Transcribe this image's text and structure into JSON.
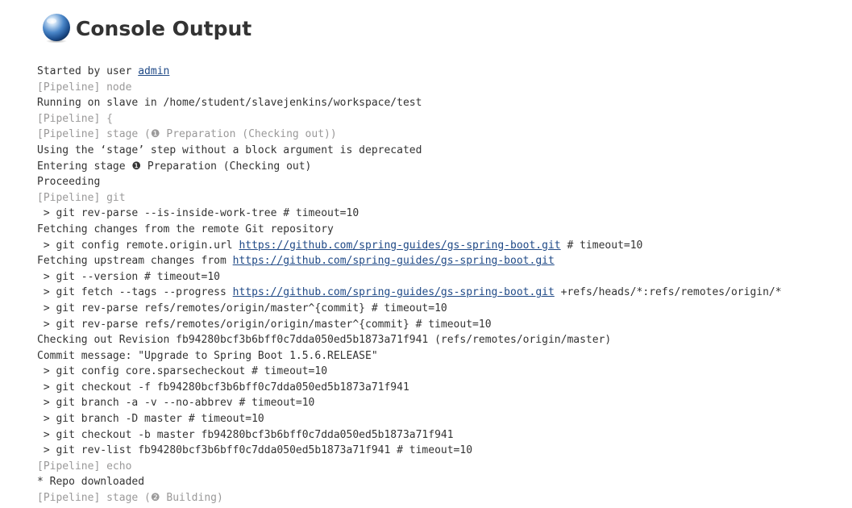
{
  "header": {
    "title": "Console Output",
    "icon": "terminal-globe-icon"
  },
  "colors": {
    "text": "#333333",
    "pipeline": "#9a9999",
    "link": "#204a87"
  },
  "lines": [
    {
      "type": "user",
      "segments": [
        {
          "text": "Started by user "
        },
        {
          "text": "admin",
          "link": true
        }
      ]
    },
    {
      "type": "pipeline",
      "segments": [
        {
          "text": "[Pipeline] node"
        }
      ]
    },
    {
      "type": "text",
      "segments": [
        {
          "text": "Running on slave in /home/student/slavejenkins/workspace/test"
        }
      ]
    },
    {
      "type": "pipeline",
      "segments": [
        {
          "text": "[Pipeline] {"
        }
      ]
    },
    {
      "type": "pipeline",
      "segments": [
        {
          "text": "[Pipeline] stage (❶ Preparation (Checking out))"
        }
      ]
    },
    {
      "type": "text",
      "segments": [
        {
          "text": "Using the ‘stage’ step without a block argument is deprecated"
        }
      ]
    },
    {
      "type": "text",
      "segments": [
        {
          "text": "Entering stage ❶ Preparation (Checking out)"
        }
      ]
    },
    {
      "type": "text",
      "segments": [
        {
          "text": "Proceeding"
        }
      ]
    },
    {
      "type": "pipeline",
      "segments": [
        {
          "text": "[Pipeline] git"
        }
      ]
    },
    {
      "type": "text",
      "segments": [
        {
          "text": " > git rev-parse --is-inside-work-tree # timeout=10"
        }
      ]
    },
    {
      "type": "text",
      "segments": [
        {
          "text": "Fetching changes from the remote Git repository"
        }
      ]
    },
    {
      "type": "text",
      "segments": [
        {
          "text": " > git config remote.origin.url "
        },
        {
          "text": "https://github.com/spring-guides/gs-spring-boot.git",
          "link": true
        },
        {
          "text": " # timeout=10"
        }
      ]
    },
    {
      "type": "text",
      "segments": [
        {
          "text": "Fetching upstream changes from "
        },
        {
          "text": "https://github.com/spring-guides/gs-spring-boot.git",
          "link": true
        }
      ]
    },
    {
      "type": "text",
      "segments": [
        {
          "text": " > git --version # timeout=10"
        }
      ]
    },
    {
      "type": "text",
      "segments": [
        {
          "text": " > git fetch --tags --progress "
        },
        {
          "text": "https://github.com/spring-guides/gs-spring-boot.git",
          "link": true
        },
        {
          "text": " +refs/heads/*:refs/remotes/origin/*"
        }
      ]
    },
    {
      "type": "text",
      "segments": [
        {
          "text": " > git rev-parse refs/remotes/origin/master^{commit} # timeout=10"
        }
      ]
    },
    {
      "type": "text",
      "segments": [
        {
          "text": " > git rev-parse refs/remotes/origin/origin/master^{commit} # timeout=10"
        }
      ]
    },
    {
      "type": "text",
      "segments": [
        {
          "text": "Checking out Revision fb94280bcf3b6bff0c7dda050ed5b1873a71f941 (refs/remotes/origin/master)"
        }
      ]
    },
    {
      "type": "text",
      "segments": [
        {
          "text": "Commit message: \"Upgrade to Spring Boot 1.5.6.RELEASE\""
        }
      ]
    },
    {
      "type": "text",
      "segments": [
        {
          "text": " > git config core.sparsecheckout # timeout=10"
        }
      ]
    },
    {
      "type": "text",
      "segments": [
        {
          "text": " > git checkout -f fb94280bcf3b6bff0c7dda050ed5b1873a71f941"
        }
      ]
    },
    {
      "type": "text",
      "segments": [
        {
          "text": " > git branch -a -v --no-abbrev # timeout=10"
        }
      ]
    },
    {
      "type": "text",
      "segments": [
        {
          "text": " > git branch -D master # timeout=10"
        }
      ]
    },
    {
      "type": "text",
      "segments": [
        {
          "text": " > git checkout -b master fb94280bcf3b6bff0c7dda050ed5b1873a71f941"
        }
      ]
    },
    {
      "type": "text",
      "segments": [
        {
          "text": " > git rev-list fb94280bcf3b6bff0c7dda050ed5b1873a71f941 # timeout=10"
        }
      ]
    },
    {
      "type": "pipeline",
      "segments": [
        {
          "text": "[Pipeline] echo"
        }
      ]
    },
    {
      "type": "text",
      "segments": [
        {
          "text": "* Repo downloaded"
        }
      ]
    },
    {
      "type": "pipeline",
      "segments": [
        {
          "text": "[Pipeline] stage (❷ Building)"
        }
      ]
    }
  ]
}
